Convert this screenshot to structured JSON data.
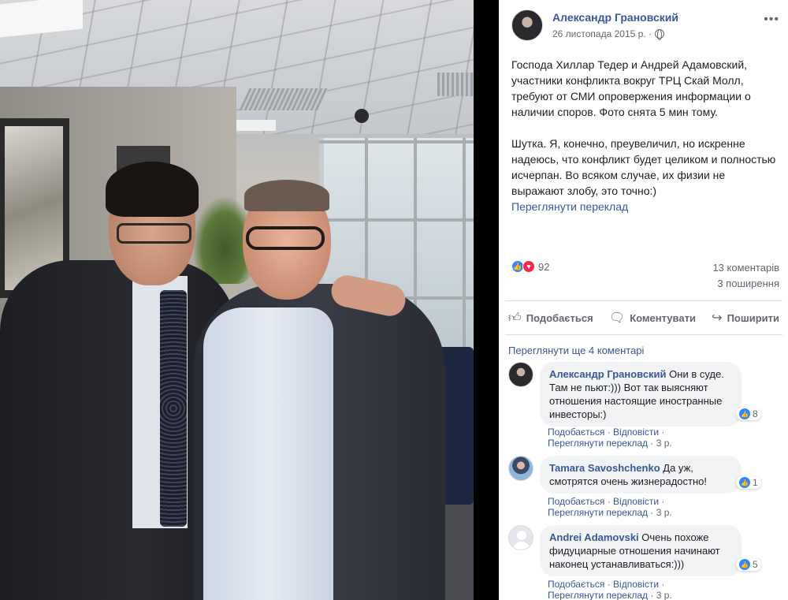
{
  "post": {
    "author": "Александр Грановский",
    "date": "26 листопада 2015 р. ·",
    "more_icon": "more-dots-icon",
    "paragraph1": "Господа Хиллар Тедер и Андрей Адамовский, участники конфликта вокруг ТРЦ Скай Молл, требуют от СМИ опровержения информации о наличии споров. Фото снята 5 мин тому.",
    "paragraph2": "Шутка. Я, конечно, преувеличил, но искренне надеюсь, что конфликт будет целиком и полностью исчерпан. Во всяком случае, их физии не выражают злобу, это точно:)",
    "see_translation": "Переглянути переклад"
  },
  "stats": {
    "reactions_count": "92",
    "comments": "13 коментарів",
    "shares": "3 поширення"
  },
  "actions": {
    "like": "Подобається",
    "comment": "Коментувати",
    "share": "Поширити"
  },
  "comments": {
    "view_more": "Переглянути ще 4 коментарі",
    "items": [
      {
        "name": "Александр Грановский",
        "text": "Они в суде. Там не пьют:))) Вот так выясняют отношения настоящие иностранные инвесторы:)",
        "likes": "8",
        "like": "Подобається",
        "reply": "Відповісти",
        "see_translation": "Переглянути переклад",
        "time": "3 р."
      },
      {
        "name": "Tamara Savoshchenko",
        "text": "Да уж, смотрятся очень жизнерадостно!",
        "likes": "1",
        "like": "Подобається",
        "reply": "Відповісти",
        "see_translation": "Переглянути переклад",
        "time": "3 р."
      },
      {
        "name": "Andrei Adamovski",
        "text": "Очень похоже фидуциарные отношения начинают наконец устанавливаться:)))",
        "likes": "5",
        "like": "Подобається",
        "reply": "Відповісти",
        "see_translation": "Переглянути переклад",
        "time": "3 р."
      }
    ]
  },
  "colors": {
    "link": "#385898",
    "secondary_text": "#606770",
    "bubble": "#f2f3f5",
    "like_blue": "#2d88ff",
    "love_red": "#f0284a"
  }
}
